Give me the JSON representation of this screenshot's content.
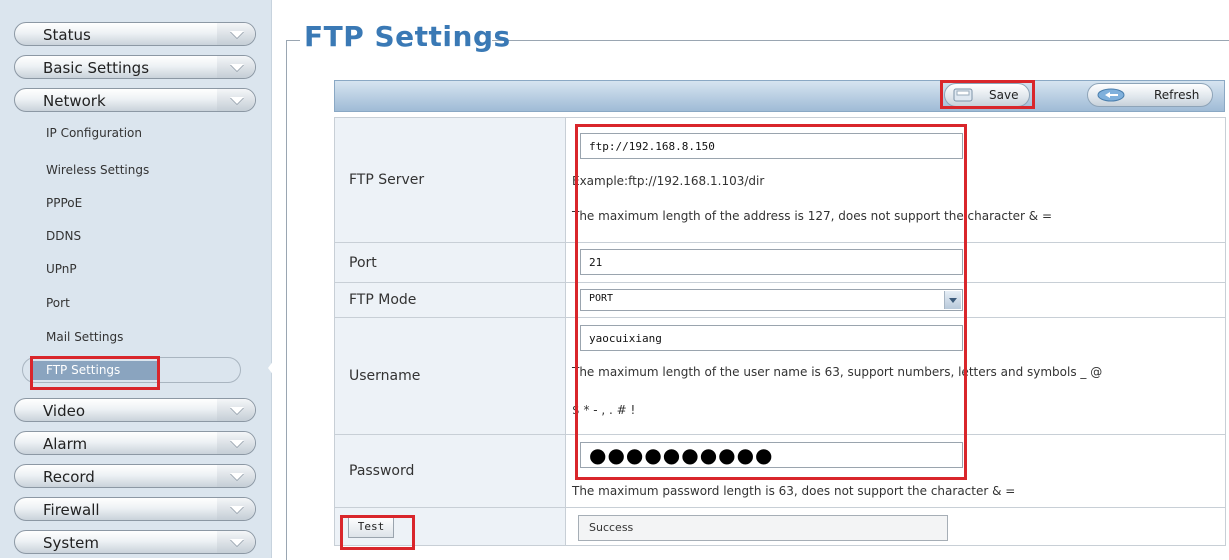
{
  "sidebar": {
    "menus_top": [
      {
        "label": "Status"
      },
      {
        "label": "Basic Settings"
      },
      {
        "label": "Network"
      }
    ],
    "network_items": [
      {
        "label": "IP Configuration"
      },
      {
        "label": "Wireless Settings"
      },
      {
        "label": "PPPoE"
      },
      {
        "label": "DDNS"
      },
      {
        "label": "UPnP"
      },
      {
        "label": "Port"
      },
      {
        "label": "Mail Settings"
      }
    ],
    "active_item": {
      "label": "FTP Settings"
    },
    "menus_bottom": [
      {
        "label": "Video"
      },
      {
        "label": "Alarm"
      },
      {
        "label": "Record"
      },
      {
        "label": "Firewall"
      },
      {
        "label": "System"
      }
    ]
  },
  "page": {
    "title": "FTP Settings"
  },
  "toolbar": {
    "save_label": "Save",
    "refresh_label": "Refresh"
  },
  "form": {
    "ftp_server": {
      "label": "FTP Server",
      "value": "ftp://192.168.8.150",
      "example": "Example:ftp://192.168.1.103/dir",
      "hint": "The maximum length of the address is 127,  does not support the character & ="
    },
    "port": {
      "label": "Port",
      "value": "21"
    },
    "ftp_mode": {
      "label": "FTP Mode",
      "selected": "PORT"
    },
    "username": {
      "label": "Username",
      "value": "yaocuixiang",
      "hint_line1": "The maximum length of the user name is 63, support numbers, letters and symbols _ @",
      "hint_line2": "$ * - , . # !"
    },
    "password": {
      "label": "Password",
      "masked": "●●●●●●●●●●",
      "hint": "The maximum password length is 63, does not support the character & ="
    },
    "test": {
      "label": "Test",
      "result": "Success"
    }
  },
  "colors": {
    "accent_title": "#3a79b5",
    "highlight_box": "#d9262b",
    "sidebar_bg": "#dbe5ee",
    "toolbar_bg": "#b3c9de"
  }
}
